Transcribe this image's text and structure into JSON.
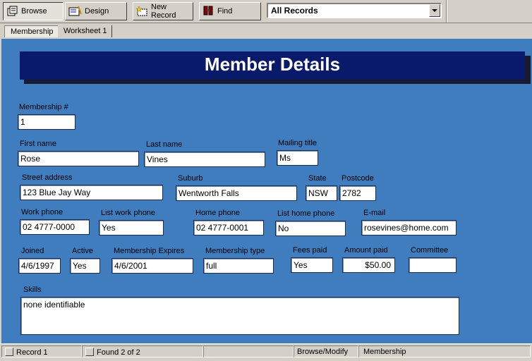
{
  "toolbar": {
    "buttons": [
      {
        "label": "Browse",
        "icon": "browse-icon",
        "pressed": true
      },
      {
        "label": "Design",
        "icon": "design-icon",
        "pressed": false
      },
      {
        "label": "New Record",
        "icon": "new-record-icon",
        "pressed": false
      },
      {
        "label": "Find",
        "icon": "find-icon",
        "pressed": false
      }
    ],
    "view_select": "All Records"
  },
  "tabs": [
    {
      "label": "Membership",
      "active": true
    },
    {
      "label": "Worksheet 1",
      "active": false
    }
  ],
  "form": {
    "title": "Member Details",
    "background_color": "#3f7dbf",
    "title_color": "#0a1a6b",
    "fields": {
      "membership_no": {
        "label": "Membership #",
        "value": "1"
      },
      "first_name": {
        "label": "First name",
        "value": "Rose"
      },
      "last_name": {
        "label": "Last name",
        "value": "Vines"
      },
      "mailing_title": {
        "label": "Mailing title",
        "value": "Ms"
      },
      "street_address": {
        "label": "Street address",
        "value": "123 Blue Jay Way"
      },
      "suburb": {
        "label": "Suburb",
        "value": "Wentworth Falls"
      },
      "state": {
        "label": "State",
        "value": "NSW"
      },
      "postcode": {
        "label": "Postcode",
        "value": "2782"
      },
      "work_phone": {
        "label": "Work phone",
        "value": "02 4777-0000"
      },
      "list_work_phone": {
        "label": "List work phone",
        "value": "Yes"
      },
      "home_phone": {
        "label": "Home phone",
        "value": "02 4777-0001"
      },
      "list_home_phone": {
        "label": "List home phone",
        "value": "No"
      },
      "email": {
        "label": "E-mail",
        "value": "rosevines@home.com"
      },
      "joined": {
        "label": "Joined",
        "value": "4/6/1997"
      },
      "active": {
        "label": "Active",
        "value": "Yes"
      },
      "membership_expires": {
        "label": "Membership Expires",
        "value": "4/6/2001"
      },
      "membership_type": {
        "label": "Membership type",
        "value": "full"
      },
      "fees_paid": {
        "label": "Fees paid",
        "value": "Yes"
      },
      "amount_paid": {
        "label": "Amount paid",
        "value": "$50.00"
      },
      "committee": {
        "label": "Committee",
        "value": ""
      },
      "skills": {
        "label": "Skills",
        "value": "none identifiable"
      }
    }
  },
  "status": {
    "record": "Record 1",
    "found": "Found 2 of 2",
    "mode": "Browse/Modify",
    "table": "Membership"
  }
}
